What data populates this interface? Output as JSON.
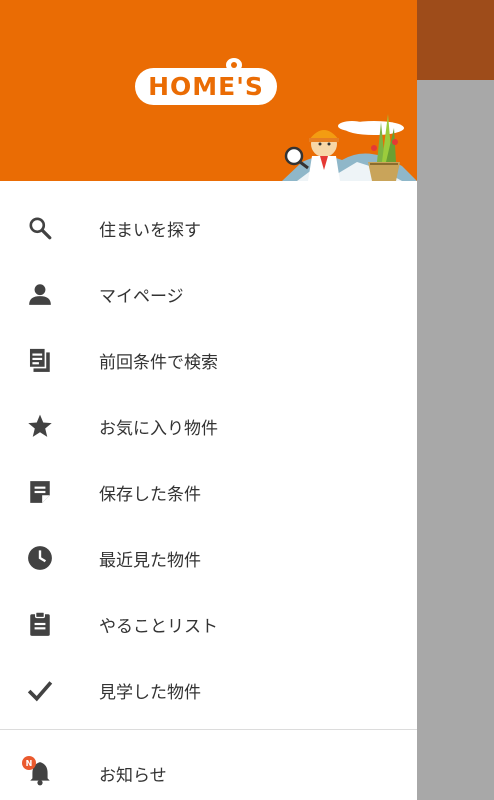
{
  "header": {
    "logo_text": "HOME'S",
    "brand_color": "#ea6c04"
  },
  "menu": [
    {
      "id": "search",
      "icon": "search-icon",
      "label": "住まいを探す"
    },
    {
      "id": "mypage",
      "icon": "person-icon",
      "label": "マイページ"
    },
    {
      "id": "last-search",
      "icon": "documents-icon",
      "label": "前回条件で検索"
    },
    {
      "id": "favorites",
      "icon": "star-icon",
      "label": "お気に入り物件"
    },
    {
      "id": "saved-conditions",
      "icon": "note-icon",
      "label": "保存した条件"
    },
    {
      "id": "recent",
      "icon": "clock-icon",
      "label": "最近見た物件"
    },
    {
      "id": "todo",
      "icon": "clipboard-icon",
      "label": "やることリスト"
    },
    {
      "id": "visited",
      "icon": "check-icon",
      "label": "見学した物件"
    }
  ],
  "notice": {
    "icon": "bell-icon",
    "badge": "N",
    "label": "お知らせ"
  },
  "colors": {
    "icon": "#424242",
    "text": "#333333",
    "badge": "#ea5a2e"
  }
}
